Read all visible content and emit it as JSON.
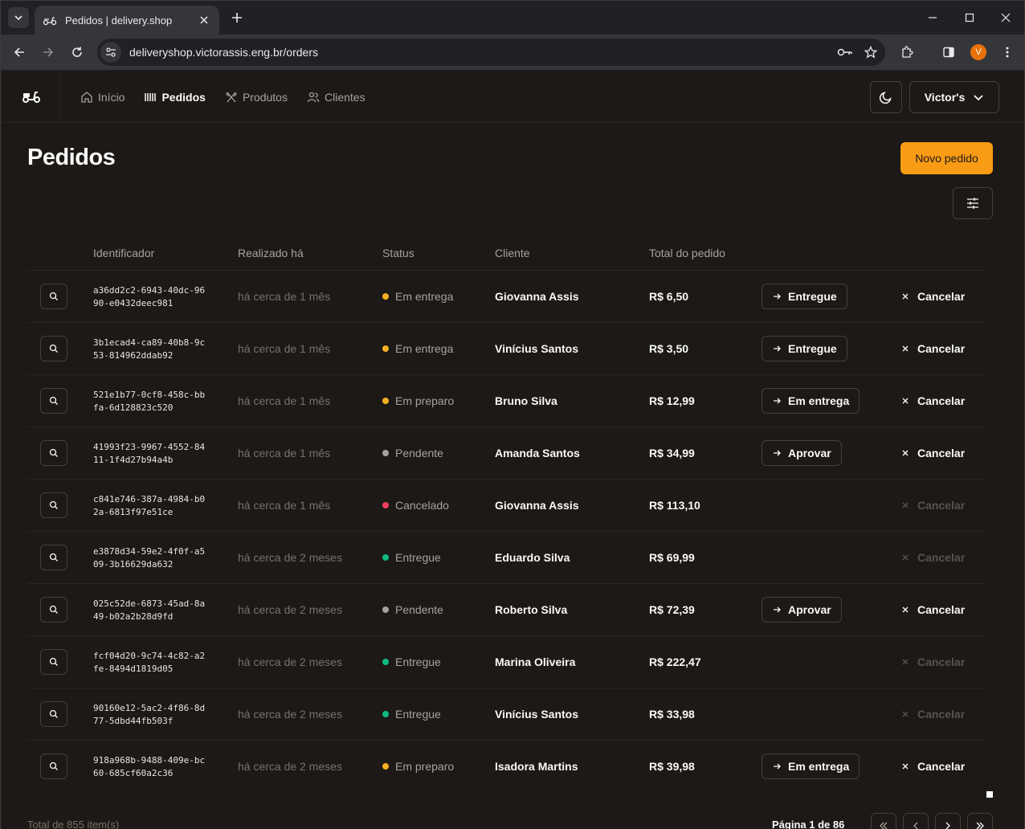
{
  "browser": {
    "tab_title": "Pedidos | delivery.shop",
    "url": "deliveryshop.victorassis.eng.br/orders",
    "profile_initial": "V"
  },
  "nav": {
    "items": [
      {
        "label": "Início",
        "icon": "home-icon"
      },
      {
        "label": "Pedidos",
        "icon": "orders-icon"
      },
      {
        "label": "Produtos",
        "icon": "utensils-icon"
      },
      {
        "label": "Clientes",
        "icon": "users-icon"
      }
    ],
    "account_label": "Victor's"
  },
  "page": {
    "title": "Pedidos",
    "new_order_label": "Novo pedido"
  },
  "table": {
    "headers": [
      "Identificador",
      "Realizado há",
      "Status",
      "Cliente",
      "Total do pedido"
    ],
    "rows": [
      {
        "id": "a36dd2c2-6943-40dc-9690-e0432deec981",
        "ago": "há cerca de 1 mês",
        "status": "Em entrega",
        "status_color": "#f5b121",
        "client": "Giovanna Assis",
        "total": "R$ 6,50",
        "action": "Entregue",
        "cancel": "Cancelar",
        "cancel_enabled": true
      },
      {
        "id": "3b1ecad4-ca89-40b8-9c53-814962ddab92",
        "ago": "há cerca de 1 mês",
        "status": "Em entrega",
        "status_color": "#f5b121",
        "client": "Vinícius Santos",
        "total": "R$ 3,50",
        "action": "Entregue",
        "cancel": "Cancelar",
        "cancel_enabled": true
      },
      {
        "id": "521e1b77-0cf8-458c-bbfa-6d128823c520",
        "ago": "há cerca de 1 mês",
        "status": "Em preparo",
        "status_color": "#f5b121",
        "client": "Bruno Silva",
        "total": "R$ 12,99",
        "action": "Em entrega",
        "cancel": "Cancelar",
        "cancel_enabled": true
      },
      {
        "id": "41993f23-9967-4552-8411-1f4d27b94a4b",
        "ago": "há cerca de 1 mês",
        "status": "Pendente",
        "status_color": "#a8a29e",
        "client": "Amanda Santos",
        "total": "R$ 34,99",
        "action": "Aprovar",
        "cancel": "Cancelar",
        "cancel_enabled": true
      },
      {
        "id": "c841e746-387a-4984-b02a-6813f97e51ce",
        "ago": "há cerca de 1 mês",
        "status": "Cancelado",
        "status_color": "#f43f5e",
        "client": "Giovanna Assis",
        "total": "R$ 113,10",
        "action": "",
        "cancel": "Cancelar",
        "cancel_enabled": false
      },
      {
        "id": "e3878d34-59e2-4f0f-a509-3b16629da632",
        "ago": "há cerca de 2 meses",
        "status": "Entregue",
        "status_color": "#10b981",
        "client": "Eduardo Silva",
        "total": "R$ 69,99",
        "action": "",
        "cancel": "Cancelar",
        "cancel_enabled": false
      },
      {
        "id": "025c52de-6873-45ad-8a49-b02a2b28d9fd",
        "ago": "há cerca de 2 meses",
        "status": "Pendente",
        "status_color": "#a8a29e",
        "client": "Roberto Silva",
        "total": "R$ 72,39",
        "action": "Aprovar",
        "cancel": "Cancelar",
        "cancel_enabled": true
      },
      {
        "id": "fcf04d20-9c74-4c82-a2fe-8494d1819d05",
        "ago": "há cerca de 2 meses",
        "status": "Entregue",
        "status_color": "#10b981",
        "client": "Marina Oliveira",
        "total": "R$ 222,47",
        "action": "",
        "cancel": "Cancelar",
        "cancel_enabled": false
      },
      {
        "id": "90160e12-5ac2-4f86-8d77-5dbd44fb503f",
        "ago": "há cerca de 2 meses",
        "status": "Entregue",
        "status_color": "#10b981",
        "client": "Vinícius Santos",
        "total": "R$ 33,98",
        "action": "",
        "cancel": "Cancelar",
        "cancel_enabled": false
      },
      {
        "id": "918a968b-9488-409e-bc60-685cf60a2c36",
        "ago": "há cerca de 2 meses",
        "status": "Em preparo",
        "status_color": "#f5b121",
        "client": "Isadora Martins",
        "total": "R$ 39,98",
        "action": "Em entrega",
        "cancel": "Cancelar",
        "cancel_enabled": true
      }
    ]
  },
  "footer": {
    "total_text": "Total de 855 item(s)",
    "page_text": "Página 1 de 86"
  }
}
